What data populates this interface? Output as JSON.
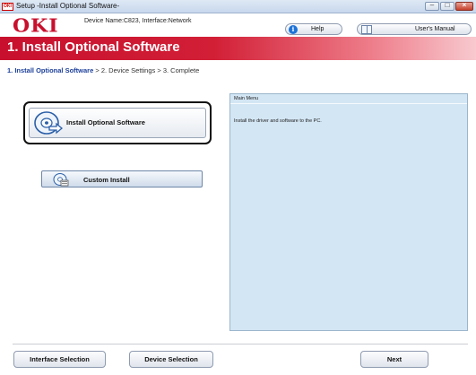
{
  "window": {
    "title": "Setup -Install Optional Software-",
    "app_icon_text": "OKI"
  },
  "header": {
    "logo": "OKI",
    "device_name": "Device Name:C823, Interface:Network",
    "help_label": "Help",
    "manual_label": "User's Manual"
  },
  "band": {
    "title": "1. Install Optional Software"
  },
  "breadcrumb": {
    "active": "1. Install Optional Software",
    "rest": " > 2. Device Settings > 3. Complete"
  },
  "main": {
    "install_optional_label": "Install Optional Software",
    "custom_install_label": "Custom Install"
  },
  "panel": {
    "title": "Main Menu",
    "text": "Install the driver and software to the PC."
  },
  "footer": {
    "interface_selection": "Interface Selection",
    "device_selection": "Device Selection",
    "next": "Next"
  },
  "colors": {
    "brand_red": "#c8102e",
    "panel_bg": "#d3e6f4",
    "breadcrumb_active": "#1b3f9a"
  },
  "icons": [
    "oki-app-icon",
    "minimize-icon",
    "maximize-icon",
    "close-icon",
    "help-icon",
    "manual-icon",
    "install-disc-icon",
    "custom-install-icon"
  ]
}
